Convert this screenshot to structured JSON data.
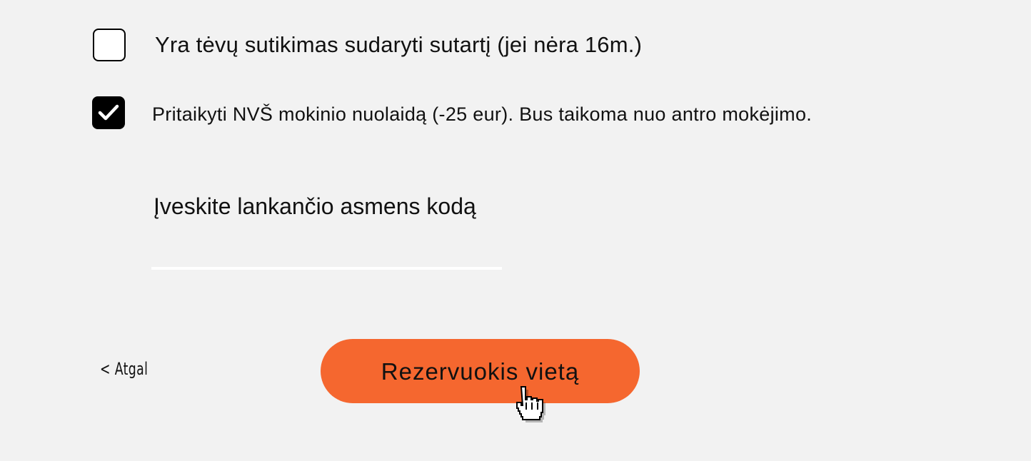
{
  "form": {
    "parent_consent": {
      "label": "Yra tėvų sutikimas sudaryti sutartį (jei nėra 16m.)",
      "checked": false
    },
    "nvs_discount": {
      "label": "Pritaikyti NVŠ mokinio nuolaidą (-25 eur). Bus taikoma nuo antro mokėjimo.",
      "checked": true
    },
    "personal_code": {
      "label": "Įveskite lankančio asmens kodą",
      "value": "",
      "placeholder": ""
    }
  },
  "actions": {
    "back_label": "< Atgal",
    "reserve_label": "Rezervuokis vietą"
  },
  "colors": {
    "background": "#f2f2f2",
    "accent": "#f5672f",
    "checkbox_checked": "#000000"
  },
  "icons": {
    "checkmark": "check-icon",
    "cursor": "hand-pointer-cursor-icon"
  }
}
